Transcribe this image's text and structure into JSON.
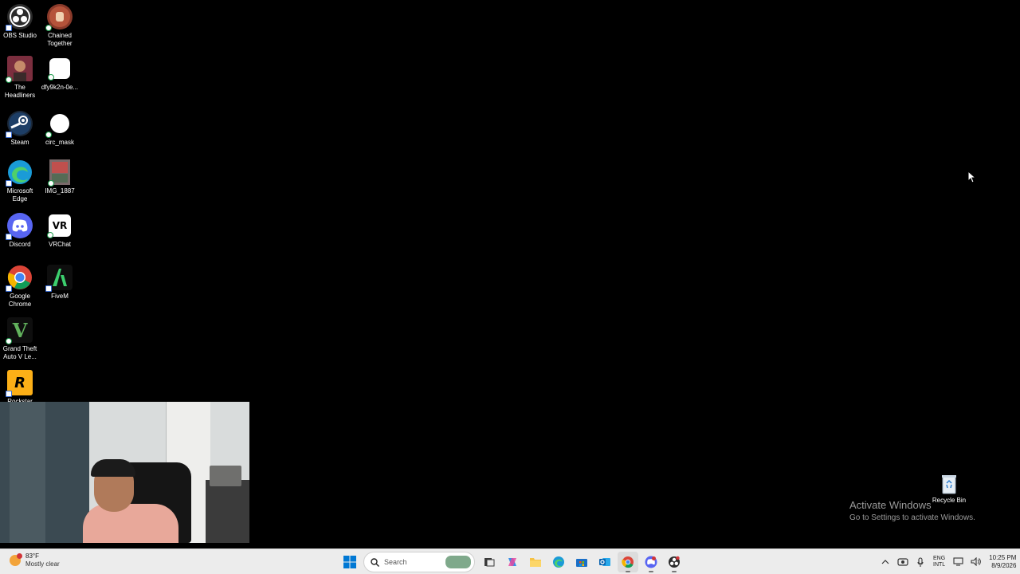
{
  "desktop": {
    "icons": [
      {
        "label": "OBS Studio",
        "glyph": "obs-icon",
        "color": "#2b2b2b"
      },
      {
        "label": "Chained Together",
        "glyph": "chained-together-icon",
        "color": "#8a3a2a"
      },
      {
        "label": "The Headliners",
        "glyph": "headliners-icon",
        "color": "#6a2a3a"
      },
      {
        "label": "dfy9k2n-0e...",
        "glyph": "blank-file-icon",
        "color": "#ffffff"
      },
      {
        "label": "Steam",
        "glyph": "steam-icon",
        "color": "#1b2838"
      },
      {
        "label": "circ_mask",
        "glyph": "circle-image-icon",
        "color": "#ffffff"
      },
      {
        "label": "Microsoft Edge",
        "glyph": "edge-icon",
        "color": "#1a9bd7"
      },
      {
        "label": "IMG_1887",
        "glyph": "photo-icon",
        "color": "#8b6d6d"
      },
      {
        "label": "Discord",
        "glyph": "discord-icon",
        "color": "#5865f2"
      },
      {
        "label": "VRChat",
        "glyph": "vrchat-icon",
        "color": "#ffffff"
      },
      {
        "label": "Google Chrome",
        "glyph": "chrome-icon",
        "color": "#db4437"
      },
      {
        "label": "FiveM",
        "glyph": "fivem-icon",
        "color": "#0e0e0e"
      },
      {
        "label": "Grand Theft Auto V Le...",
        "glyph": "gta-v-icon",
        "color": "#0e0e0e"
      },
      {
        "label": "Rockstar",
        "glyph": "rockstar-icon",
        "color": "#fcaf17"
      }
    ],
    "vr_text": "VR",
    "rockstar_text": "R",
    "gta_text": "V",
    "recycle_bin": "Recycle Bin",
    "watermark": {
      "title": "Activate Windows",
      "subtitle": "Go to Settings to activate Windows."
    }
  },
  "taskbar": {
    "weather": {
      "temp": "83°F",
      "condition": "Mostly clear"
    },
    "search_placeholder": "Search",
    "apps": [
      {
        "name": "task-view-icon"
      },
      {
        "name": "copilot-icon"
      },
      {
        "name": "file-explorer-icon"
      },
      {
        "name": "edge-icon"
      },
      {
        "name": "microsoft-store-icon"
      },
      {
        "name": "outlook-icon"
      },
      {
        "name": "chrome-icon"
      },
      {
        "name": "discord-icon"
      },
      {
        "name": "obs-icon"
      }
    ],
    "tray": {
      "lang_line1": "ENG",
      "lang_line2": "INTL",
      "time": "10:25 PM",
      "date": "8/9/2026"
    }
  },
  "colors": {
    "desktop_bg": "#000000",
    "taskbar_bg": "#ececec",
    "windows_blue": "#0078d4"
  }
}
